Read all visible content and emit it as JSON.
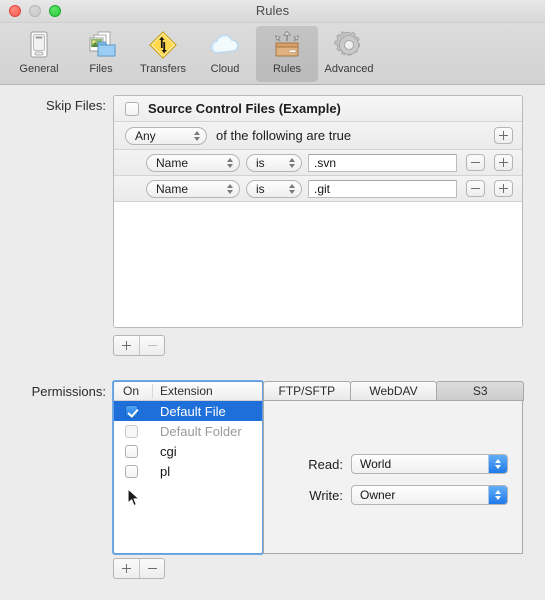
{
  "window": {
    "title": "Rules",
    "controls": [
      {
        "name": "close-button",
        "color": "#fb5a51"
      },
      {
        "name": "minimize-button",
        "color": "#c6c6c6"
      },
      {
        "name": "zoom-button",
        "color": "#28cd41"
      }
    ]
  },
  "toolbar": {
    "items": [
      {
        "label": "General",
        "icon": "general-icon",
        "selected": false
      },
      {
        "label": "Files",
        "icon": "files-icon",
        "selected": false
      },
      {
        "label": "Transfers",
        "icon": "transfers-icon",
        "selected": false
      },
      {
        "label": "Cloud",
        "icon": "cloud-icon",
        "selected": false
      },
      {
        "label": "Rules",
        "icon": "rules-icon",
        "selected": true
      },
      {
        "label": "Advanced",
        "icon": "advanced-icon",
        "selected": false
      }
    ]
  },
  "skip_files": {
    "label": "Skip Files:",
    "group_checkbox_checked": false,
    "group_title": "Source Control Files (Example)",
    "match_mode": "Any",
    "match_suffix": "of the following are true",
    "add_button": "+",
    "rules": [
      {
        "field": "Name",
        "operator": "is",
        "value": ".svn",
        "remove_button": "−",
        "add_button": "+"
      },
      {
        "field": "Name",
        "operator": "is",
        "value": ".git",
        "remove_button": "−",
        "add_button": "+"
      }
    ],
    "footer": {
      "add_label": "+",
      "remove_label": "−",
      "remove_enabled": false
    }
  },
  "permissions": {
    "label": "Permissions:",
    "columns": [
      "On",
      "Extension"
    ],
    "rows": [
      {
        "extension": "Default File",
        "checked": true,
        "selected": true,
        "disabled": false
      },
      {
        "extension": "Default Folder",
        "checked": false,
        "selected": false,
        "disabled": true
      },
      {
        "extension": "cgi",
        "checked": false,
        "selected": false,
        "disabled": false
      },
      {
        "extension": "pl",
        "checked": false,
        "selected": false,
        "disabled": false
      }
    ],
    "footer": {
      "add_label": "+",
      "remove_label": "−",
      "remove_enabled": true
    },
    "tabs": [
      {
        "label": "FTP/SFTP",
        "active": false
      },
      {
        "label": "WebDAV",
        "active": false
      },
      {
        "label": "S3",
        "active": true
      }
    ],
    "fields": [
      {
        "label": "Read:",
        "value": "World"
      },
      {
        "label": "Write:",
        "value": "Owner"
      }
    ]
  },
  "colors": {
    "selection_blue": "#1e6fd9",
    "focus_ring": "#5b9de7",
    "popup_blue": "#2179e8",
    "window_bg": "#ececec"
  }
}
